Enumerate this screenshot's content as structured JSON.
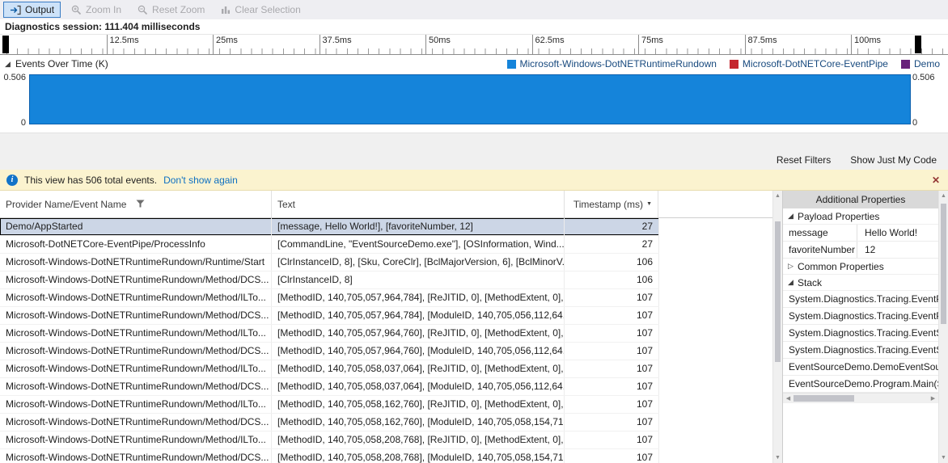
{
  "toolbar": {
    "output": "Output",
    "zoom_in": "Zoom In",
    "reset_zoom": "Reset Zoom",
    "clear_selection": "Clear Selection"
  },
  "session": {
    "text": "Diagnostics session: 111.404 milliseconds"
  },
  "timeline": {
    "ticks": [
      "12.5ms",
      "25ms",
      "37.5ms",
      "50ms",
      "62.5ms",
      "75ms",
      "87.5ms",
      "100ms"
    ]
  },
  "chart": {
    "title": "Events Over Time (K)",
    "y_max": "0.506",
    "y_min": "0",
    "fill_color": "#1584da",
    "legend": [
      {
        "label": "Microsoft-Windows-DotNETRuntimeRundown",
        "color": "#1584da"
      },
      {
        "label": "Microsoft-DotNETCore-EventPipe",
        "color": "#c4262e"
      },
      {
        "label": "Demo",
        "color": "#68217a"
      }
    ]
  },
  "chart_data": {
    "type": "area",
    "title": "Events Over Time (K)",
    "x_unit": "ms",
    "x_range": [
      0,
      111.404
    ],
    "ylim": [
      0,
      0.506
    ],
    "y_axis_labels": [
      "0",
      "0.506"
    ],
    "legend_position": "top-right",
    "series": [
      {
        "name": "Microsoft-Windows-DotNETRuntimeRundown",
        "color": "#1584da",
        "x": [
          0,
          111.404
        ],
        "values": [
          0.506,
          0.506
        ]
      },
      {
        "name": "Microsoft-DotNETCore-EventPipe",
        "color": "#c4262e",
        "x": [],
        "values": []
      },
      {
        "name": "Demo",
        "color": "#68217a",
        "x": [],
        "values": []
      }
    ]
  },
  "links": {
    "reset_filters": "Reset Filters",
    "show_just_my_code": "Show Just My Code"
  },
  "infobar": {
    "message": "This view has 506 total events.",
    "dont_show_again": "Don't show again"
  },
  "table": {
    "columns": [
      "Provider Name/Event Name",
      "Text",
      "Timestamp (ms)"
    ],
    "selected_index": 0,
    "rows": [
      {
        "provider": "Demo/AppStarted",
        "text": "[message, Hello World!], [favoriteNumber, 12]",
        "timestamp": "27"
      },
      {
        "provider": "Microsoft-DotNETCore-EventPipe/ProcessInfo",
        "text": "[CommandLine, \"EventSourceDemo.exe\"], [OSInformation, Wind...",
        "timestamp": "27"
      },
      {
        "provider": "Microsoft-Windows-DotNETRuntimeRundown/Runtime/Start",
        "text": "[ClrInstanceID, 8], [Sku, CoreClr], [BclMajorVersion, 6], [BclMinorV...",
        "timestamp": "106"
      },
      {
        "provider": "Microsoft-Windows-DotNETRuntimeRundown/Method/DCS...",
        "text": "[ClrInstanceID, 8]",
        "timestamp": "106"
      },
      {
        "provider": "Microsoft-Windows-DotNETRuntimeRundown/Method/ILTo...",
        "text": "[MethodID, 140,705,057,964,784], [ReJITID, 0], [MethodExtent, 0],...",
        "timestamp": "107"
      },
      {
        "provider": "Microsoft-Windows-DotNETRuntimeRundown/Method/DCS...",
        "text": "[MethodID, 140,705,057,964,784], [ModuleID, 140,705,056,112,64...",
        "timestamp": "107"
      },
      {
        "provider": "Microsoft-Windows-DotNETRuntimeRundown/Method/ILTo...",
        "text": "[MethodID, 140,705,057,964,760], [ReJITID, 0], [MethodExtent, 0],...",
        "timestamp": "107"
      },
      {
        "provider": "Microsoft-Windows-DotNETRuntimeRundown/Method/DCS...",
        "text": "[MethodID, 140,705,057,964,760], [ModuleID, 140,705,056,112,64...",
        "timestamp": "107"
      },
      {
        "provider": "Microsoft-Windows-DotNETRuntimeRundown/Method/ILTo...",
        "text": "[MethodID, 140,705,058,037,064], [ReJITID, 0], [MethodExtent, 0],...",
        "timestamp": "107"
      },
      {
        "provider": "Microsoft-Windows-DotNETRuntimeRundown/Method/DCS...",
        "text": "[MethodID, 140,705,058,037,064], [ModuleID, 140,705,056,112,64...",
        "timestamp": "107"
      },
      {
        "provider": "Microsoft-Windows-DotNETRuntimeRundown/Method/ILTo...",
        "text": "[MethodID, 140,705,058,162,760], [ReJITID, 0], [MethodExtent, 0],...",
        "timestamp": "107"
      },
      {
        "provider": "Microsoft-Windows-DotNETRuntimeRundown/Method/DCS...",
        "text": "[MethodID, 140,705,058,162,760], [ModuleID, 140,705,058,154,71...",
        "timestamp": "107"
      },
      {
        "provider": "Microsoft-Windows-DotNETRuntimeRundown/Method/ILTo...",
        "text": "[MethodID, 140,705,058,208,768], [ReJITID, 0], [MethodExtent, 0],...",
        "timestamp": "107"
      },
      {
        "provider": "Microsoft-Windows-DotNETRuntimeRundown/Method/DCS...",
        "text": "[MethodID, 140,705,058,208,768], [ModuleID, 140,705,058,154,71...",
        "timestamp": "107"
      }
    ]
  },
  "properties": {
    "title": "Additional Properties",
    "payload_section": "Payload Properties",
    "common_section": "Common Properties",
    "stack_section": "Stack",
    "payload": [
      {
        "key": "message",
        "value": "Hello World!"
      },
      {
        "key": "favoriteNumber",
        "value": "12"
      }
    ],
    "stack": [
      "System.Diagnostics.Tracing.EventPip",
      "System.Diagnostics.Tracing.EventPro",
      "System.Diagnostics.Tracing.EventSou",
      "System.Diagnostics.Tracing.EventSou",
      "EventSourceDemo.DemoEventSour",
      "EventSourceDemo.Program.Main(Sy"
    ]
  },
  "icons": {
    "expanded": "◢",
    "collapsed": "▷",
    "sort_descending": "▼",
    "close": "✕",
    "info": "i",
    "scroll_up": "▲",
    "scroll_down": "▼",
    "scroll_left": "◀",
    "scroll_right": "▶"
  }
}
